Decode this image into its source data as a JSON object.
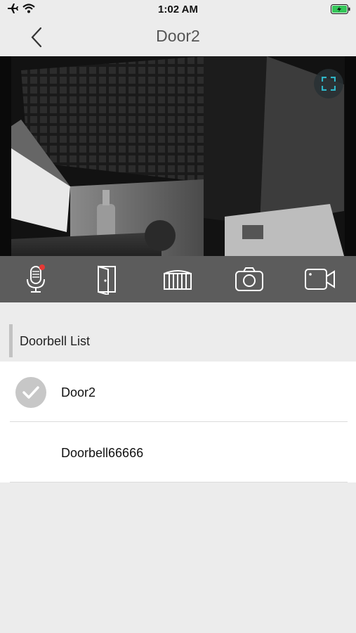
{
  "status_bar": {
    "time": "1:02 AM",
    "airplane_icon": "airplane-icon",
    "wifi_icon": "wifi-icon",
    "battery_icon": "battery-charging-icon"
  },
  "nav": {
    "title": "Door2",
    "back_icon": "chevron-left-icon"
  },
  "video": {
    "fullscreen_icon": "fullscreen-icon"
  },
  "controls": [
    {
      "icon": "microphone-icon"
    },
    {
      "icon": "door-icon"
    },
    {
      "icon": "gate-icon"
    },
    {
      "icon": "camera-icon"
    },
    {
      "icon": "video-record-icon"
    }
  ],
  "section": {
    "title": "Doorbell List"
  },
  "doorbells": [
    {
      "label": "Door2",
      "selected": true
    },
    {
      "label": "Doorbell66666",
      "selected": false
    }
  ],
  "colors": {
    "background": "#ececec",
    "control_bar": "#5c5c5c",
    "accent_teal": "#2fb7c9",
    "mic_dot": "#e53935",
    "battery_green": "#34c759"
  }
}
